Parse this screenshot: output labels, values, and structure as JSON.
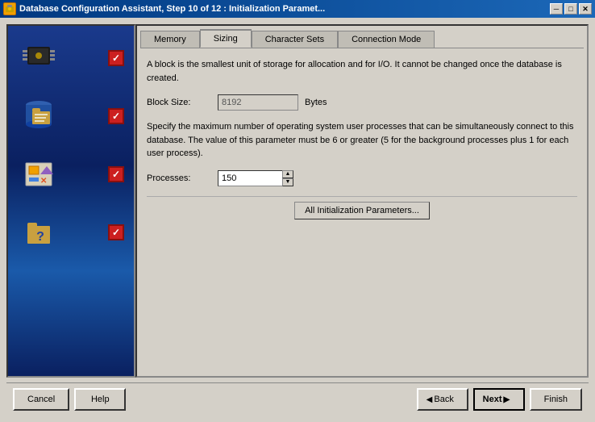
{
  "window": {
    "title": "Database Configuration Assistant, Step 10 of 12 : Initialization Paramet...",
    "title_icon": "🗄"
  },
  "title_bar_buttons": {
    "minimize": "─",
    "maximize": "□",
    "close": "✕"
  },
  "tabs": [
    {
      "id": "memory",
      "label": "Memory",
      "active": false
    },
    {
      "id": "sizing",
      "label": "Sizing",
      "active": true
    },
    {
      "id": "character_sets",
      "label": "Character Sets",
      "active": false
    },
    {
      "id": "connection_mode",
      "label": "Connection Mode",
      "active": false
    }
  ],
  "content": {
    "description1": "A block is the smallest unit of storage for allocation and for I/O. It cannot be changed once the database is created.",
    "block_size_label": "Block Size:",
    "block_size_value": "8192",
    "block_size_unit": "Bytes",
    "description2": "Specify the maximum number of operating system user processes that can be simultaneously connect to this database. The value of this parameter must be 6 or greater (5 for the background processes plus 1 for each user process).",
    "processes_label": "Processes:",
    "processes_value": "150"
  },
  "all_params_button": "All Initialization Parameters...",
  "bottom": {
    "cancel_label": "Cancel",
    "help_label": "Help",
    "back_label": "Back",
    "next_label": "Next",
    "finish_label": "Finish"
  },
  "sidebar": {
    "items": [
      {
        "icon": "chip",
        "has_check": true
      },
      {
        "icon": "folder-docs",
        "has_check": true
      },
      {
        "icon": "shapes",
        "has_check": true
      },
      {
        "icon": "folder-question",
        "has_check": true
      }
    ]
  }
}
